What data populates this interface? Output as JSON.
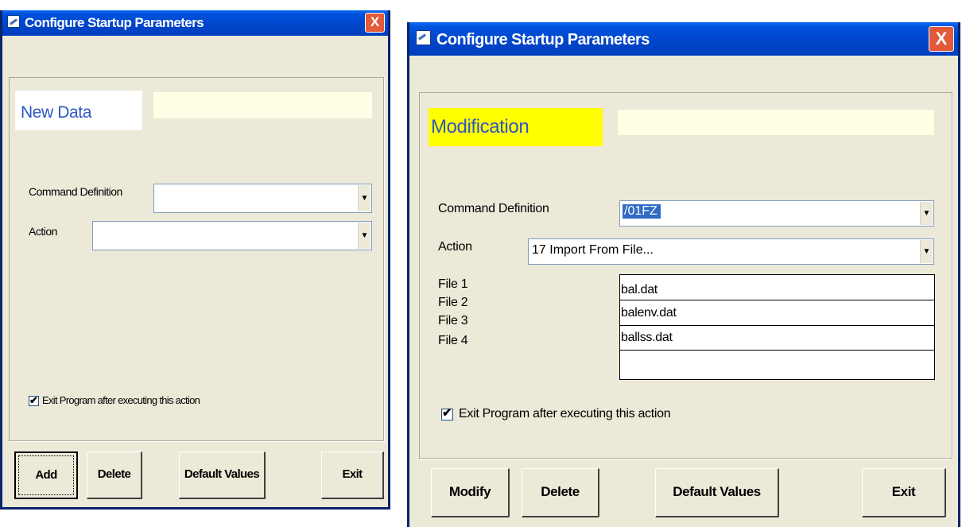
{
  "windows": [
    {
      "title": "Configure Startup Parameters",
      "close_glyph": "X",
      "mode_label": "New Data",
      "command_definition": {
        "label": "Command Definition",
        "value": ""
      },
      "action": {
        "label": "Action",
        "value": ""
      },
      "exit_checkbox": {
        "label": "Exit Program after executing this action",
        "checked": true,
        "glyph": "✔"
      },
      "buttons": {
        "primary": "Add",
        "delete": "Delete",
        "defaults": "Default Values",
        "exit": "Exit"
      }
    },
    {
      "title": "Configure Startup Parameters",
      "close_glyph": "X",
      "mode_label": "Modification",
      "command_definition": {
        "label": "Command Definition",
        "value": "/01FZ"
      },
      "action": {
        "label": "Action",
        "value": "17  Import From File..."
      },
      "files": [
        {
          "label": "File 1",
          "value": "bal.dat"
        },
        {
          "label": "File 2",
          "value": "balenv.dat"
        },
        {
          "label": "File 3",
          "value": "ballss.dat"
        },
        {
          "label": "File 4",
          "value": ""
        }
      ],
      "exit_checkbox": {
        "label": "Exit Program after executing this action",
        "checked": true,
        "glyph": "✔"
      },
      "buttons": {
        "primary": "Modify",
        "delete": "Delete",
        "defaults": "Default Values",
        "exit": "Exit"
      }
    }
  ],
  "icons": {
    "dropdown": "▼",
    "app": "configure-app-icon",
    "close": "close-icon",
    "check": "checkmark-icon"
  },
  "colors": {
    "titlebar": "#0049c8",
    "window_bg": "#ece9d8",
    "close_button": "#e25a3a",
    "modification_highlight": "#ffff00",
    "mode_text": "#2d57c4",
    "selection": "#316ac5",
    "info_field": "#ffffe6"
  }
}
